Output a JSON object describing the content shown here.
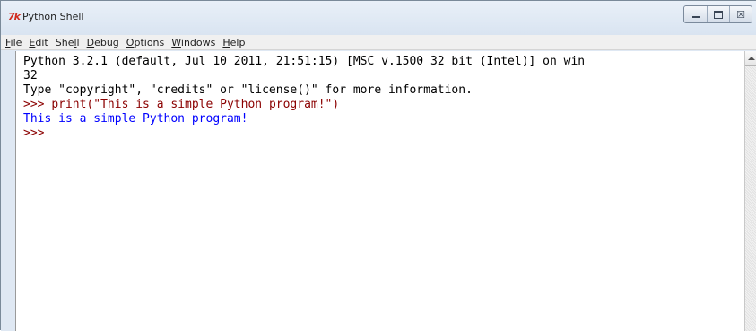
{
  "window": {
    "title": "Python Shell",
    "icon": "python-tk-feather-icon",
    "controls": {
      "minimize_icon": "minimize-icon",
      "maximize_icon": "maximize-icon",
      "close_glyph": "☒"
    }
  },
  "menu": {
    "items": [
      {
        "pre": "",
        "u": "F",
        "post": "ile"
      },
      {
        "pre": "",
        "u": "E",
        "post": "dit"
      },
      {
        "pre": "She",
        "u": "l",
        "post": "l"
      },
      {
        "pre": "",
        "u": "D",
        "post": "ebug"
      },
      {
        "pre": "",
        "u": "O",
        "post": "ptions"
      },
      {
        "pre": "",
        "u": "W",
        "post": "indows"
      },
      {
        "pre": "",
        "u": "H",
        "post": "elp"
      }
    ]
  },
  "shell": {
    "banner_line1": "Python 3.2.1 (default, Jul 10 2011, 21:51:15) [MSC v.1500 32 bit (Intel)] on win",
    "banner_line2": "32",
    "banner_line3": "Type \"copyright\", \"credits\" or \"license()\" for more information.",
    "prompt1": ">>> ",
    "input1": "print(\"This is a simple Python program!\")",
    "output1": "This is a simple Python program!",
    "prompt2": ">>>"
  },
  "colors": {
    "stdin": "#8b0000",
    "stdout": "#0000ff",
    "chrome": "#dfe8f3"
  }
}
